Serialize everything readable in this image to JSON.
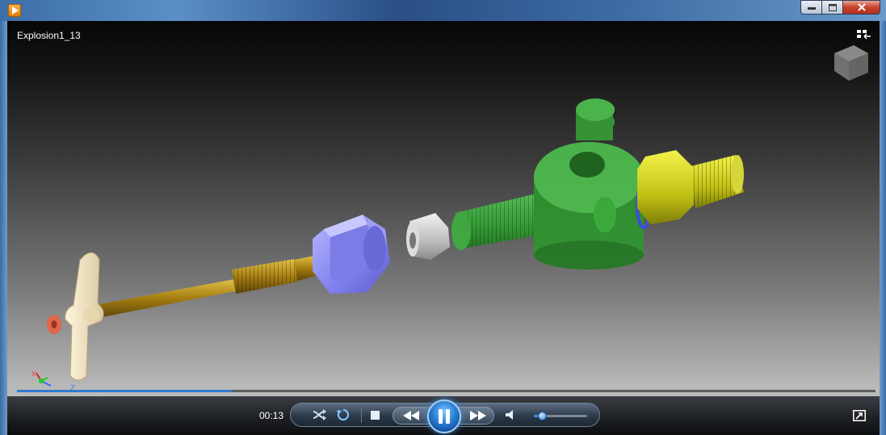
{
  "window": {
    "title": "Explosion1_13",
    "app_icon": "media-player-icon",
    "caption_buttons": [
      "minimize-icon",
      "maximize-icon",
      "close-icon"
    ]
  },
  "player": {
    "elapsed": "00:13",
    "progress": 0.25,
    "volume": 0.15,
    "state": "playing"
  },
  "controls": [
    {
      "name": "shuffle",
      "icon": "shuffle-icon"
    },
    {
      "name": "repeat",
      "icon": "repeat-icon"
    },
    {
      "name": "stop",
      "icon": "stop-icon"
    },
    {
      "name": "previous",
      "icon": "rewind-icon"
    },
    {
      "name": "play-pause",
      "icon": "pause-icon"
    },
    {
      "name": "next",
      "icon": "fast-forward-icon"
    },
    {
      "name": "mute",
      "icon": "speaker-icon"
    },
    {
      "name": "switch-to-library",
      "icon": "switch-view-icon"
    }
  ],
  "viewport_overlays": {
    "fullscreen_icon": "fullscreen-toggle-icon",
    "viewcube_icon": "viewcube-icon",
    "axis_triad": "xyz-axis-triad-icon",
    "axis_labels": [
      "X",
      "Z"
    ]
  },
  "colors": {
    "accent": "#2f7cd0",
    "part_green": "#3fbf3f",
    "part_blue": "#8f8ff5",
    "part_brass": "#b8961f",
    "part_yellow": "#d8d820",
    "part_ivory": "#f2e6c8"
  }
}
